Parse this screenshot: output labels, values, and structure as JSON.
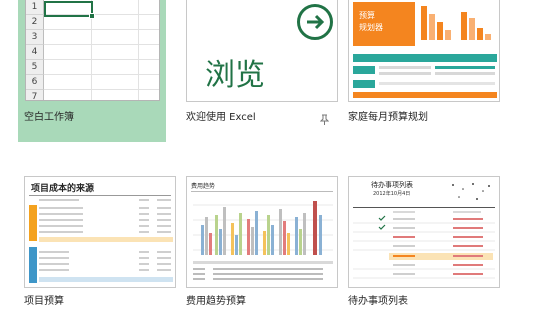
{
  "templates": [
    {
      "name": "空白工作簿",
      "selected": true
    },
    {
      "name": "欢迎使用 Excel"
    },
    {
      "name": "家庭每月预算规划"
    },
    {
      "name": "项目预算"
    },
    {
      "name": "费用趋势预算"
    },
    {
      "name": "待办事项列表"
    }
  ],
  "blank": {
    "rows": [
      "1",
      "2",
      "3",
      "4",
      "5",
      "6",
      "7"
    ]
  },
  "tour": {
    "text": "浏览",
    "arrow": "→"
  },
  "home_budget": {
    "title1": "预算",
    "title2": "规划器",
    "accent": "#f4851f"
  },
  "project_budget": {
    "title": "项目成本的来源"
  },
  "expense_trend": {
    "title": "费用趋势"
  },
  "todo": {
    "title": "待办事项列表",
    "date": "2012年10月4日"
  },
  "colors": {
    "selected_bg": "#a9d9b9",
    "excel_green": "#217346"
  },
  "icons": {
    "pin": "pin-icon"
  }
}
